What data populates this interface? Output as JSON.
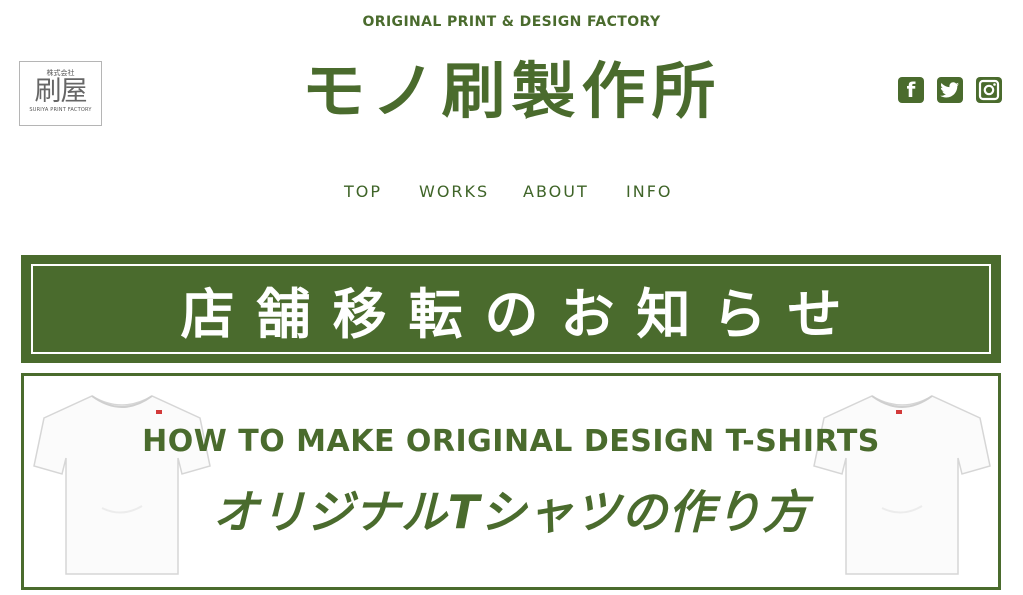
{
  "header": {
    "tagline": "ORIGINAL PRINT & DESIGN FACTORY",
    "site_title": "モノ刷製作所",
    "logo": {
      "company": "株式会社",
      "mark": "刷屋",
      "subtitle": "SURIYA PRINT FACTORY"
    },
    "social": [
      {
        "name": "facebook",
        "glyph": "f"
      },
      {
        "name": "twitter",
        "glyph": "t"
      },
      {
        "name": "instagram",
        "glyph": "◎"
      }
    ]
  },
  "nav": {
    "items": [
      "TOP",
      "WORKS",
      "ABOUT",
      "INFO"
    ]
  },
  "banners": {
    "notice": {
      "text": "店舗移転のお知らせ"
    },
    "tshirt": {
      "en": "HOW TO MAKE ORIGINAL DESIGN T-SHIRTS",
      "jp": "オリジナルTシャツの作り方"
    }
  },
  "colors": {
    "brand_green": "#4a6b2d",
    "background": "#ffffff"
  }
}
